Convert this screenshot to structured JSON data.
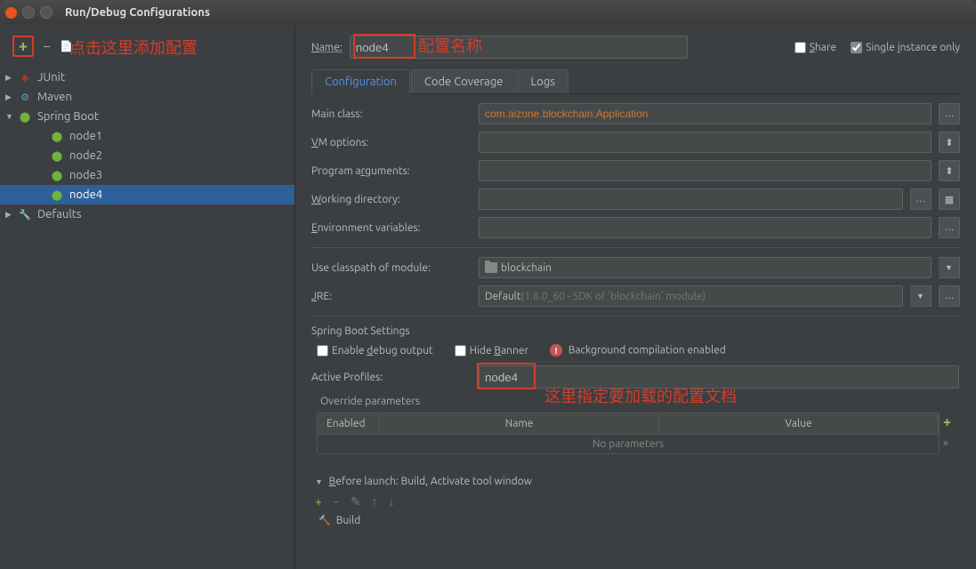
{
  "window": {
    "title": "Run/Debug Configurations"
  },
  "annotations": {
    "add_config": "点击这里添加配置",
    "config_name": "配置名称",
    "profile_doc": "这里指定要加载的配置文档"
  },
  "tree": {
    "junit": "JUnit",
    "maven": "Maven",
    "spring_boot": "Spring Boot",
    "nodes": [
      "node1",
      "node2",
      "node3",
      "node4"
    ],
    "defaults": "Defaults"
  },
  "name_row": {
    "label": "Name:",
    "value": "node4",
    "share": "Share",
    "single": "Single instance only"
  },
  "tabs": {
    "configuration": "Configuration",
    "coverage": "Code Coverage",
    "logs": "Logs"
  },
  "form": {
    "main_class_label": "Main class:",
    "main_class_value": "com.aizone.blockchain.Application",
    "vm_options": "VM options:",
    "prog_args": "Program arguments:",
    "work_dir": "Working directory:",
    "env_vars": "Environment variables:",
    "classpath_label": "Use classpath of module:",
    "classpath_value": "blockchain",
    "jre_label": "JRE:",
    "jre_default": "Default ",
    "jre_hint": "(1.8.0_60 - SDK of 'blockchain' module)"
  },
  "spring": {
    "section_title": "Spring Boot Settings",
    "debug_output": "Enable debug output",
    "hide_banner": "Hide Banner",
    "bg_compile": "Background compilation enabled",
    "profiles_label": "Active Profiles:",
    "profiles_value": "node4"
  },
  "override": {
    "title": "Override parameters",
    "enabled": "Enabled",
    "name": "Name",
    "value": "Value",
    "empty": "No parameters"
  },
  "before": {
    "label": "Before launch: Build, Activate tool window",
    "build": "Build"
  }
}
